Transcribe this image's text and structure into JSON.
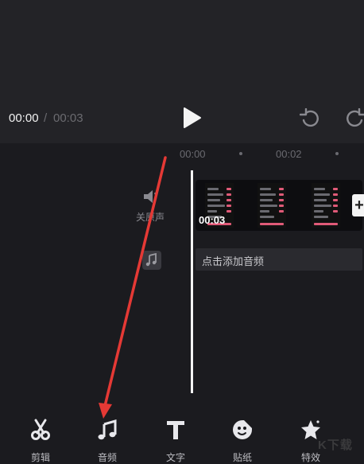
{
  "player": {
    "current_time": "00:00",
    "separator": "/",
    "total_time": "00:03"
  },
  "ruler": {
    "labels": [
      "00:00",
      "00:02"
    ]
  },
  "track_controls": {
    "mute_label": "关原声"
  },
  "clip": {
    "duration": "00:03",
    "add_symbol": "+"
  },
  "audio_track": {
    "label": "点击添加音频"
  },
  "toolbar": {
    "items": [
      {
        "label": "剪辑",
        "icon": "scissors-icon"
      },
      {
        "label": "音频",
        "icon": "music-note-icon"
      },
      {
        "label": "文字",
        "icon": "text-icon"
      },
      {
        "label": "贴纸",
        "icon": "sticker-icon"
      },
      {
        "label": "特效",
        "icon": "star-effect-icon"
      }
    ]
  },
  "watermark": "K下载",
  "colors": {
    "background": "#1b1b1f",
    "panel": "#232327",
    "accent_pink": "#e05a78",
    "arrow_red": "#e53935"
  }
}
